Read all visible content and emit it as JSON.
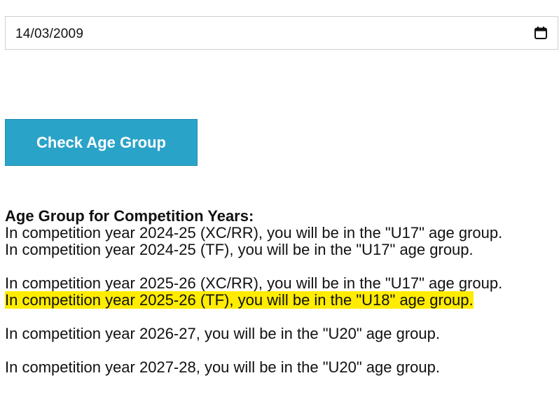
{
  "date_input": {
    "value": "14/03/2009"
  },
  "check_button": {
    "label": "Check Age Group"
  },
  "results": {
    "heading": "Age Group for Competition Years:",
    "lines": [
      "In competition year 2024-25 (XC/RR), you will be in the \"U17\" age group.",
      "In competition year 2024-25 (TF), you will be in the \"U17\" age group.",
      "In competition year 2025-26 (XC/RR), you will be in the \"U17\" age group.",
      "In competition year 2025-26 (TF), you will be in the \"U18\" age group.",
      "In competition year 2026-27, you will be in the \"U20\" age group.",
      "In competition year 2027-28, you will be in the \"U20\" age group."
    ],
    "highlight_color": "#ffec00"
  },
  "colors": {
    "button_bg": "#2aa3c9",
    "button_text": "#ffffff"
  }
}
